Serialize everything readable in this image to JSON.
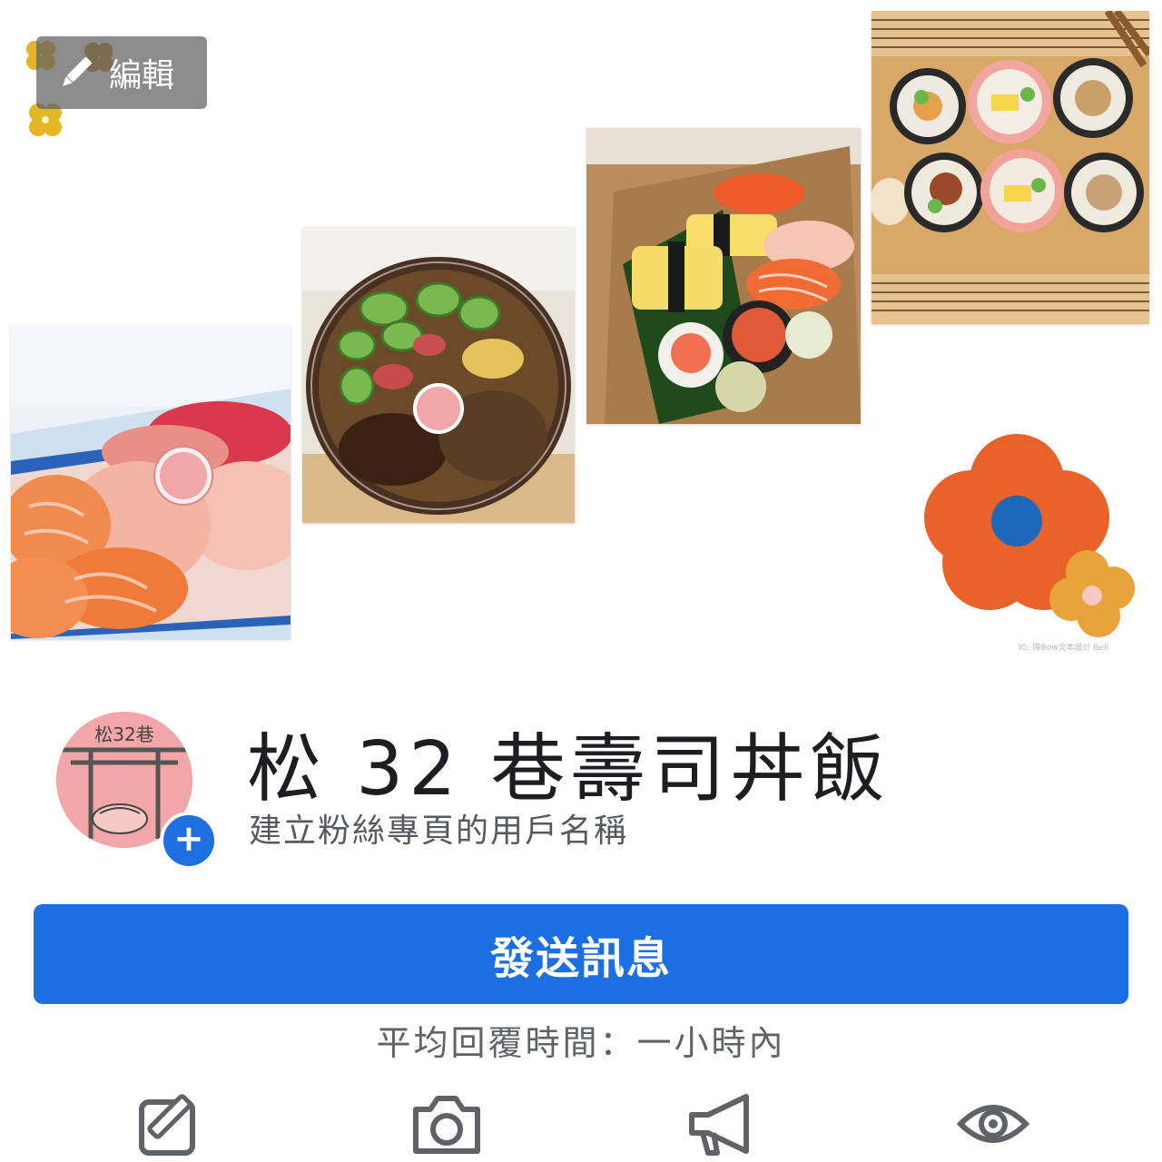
{
  "cover": {
    "edit_label": "編輯",
    "edit_icon": "pencil-icon",
    "credit_text": "IG: 陳Bow文本設計 Bell",
    "photos": [
      {
        "name": "salmon-tuna-nigiri-box"
      },
      {
        "name": "chicken-cucumber-donburi-bowl"
      },
      {
        "name": "nigiri-assortment-box"
      },
      {
        "name": "maki-roll-platter"
      }
    ],
    "decorations": [
      "clover-flowers-decoration",
      "orange-flower-decoration"
    ]
  },
  "profile": {
    "avatar_text": "松32巷",
    "page_name": "松 32 巷壽司丼飯",
    "username_hint": "建立粉絲專頁的用戶名稱",
    "add_icon": "plus-icon"
  },
  "actions": {
    "send_message_label": "發送訊息",
    "response_time": "平均回覆時間：一小時內",
    "icons": [
      "edit-post-icon",
      "camera-icon",
      "megaphone-icon",
      "eye-icon"
    ]
  },
  "colors": {
    "primary_blue": "#1b6fe0",
    "flower_orange": "#e8622a",
    "flower_blue": "#1e69b7",
    "avatar_pink": "#f2a6a8"
  }
}
